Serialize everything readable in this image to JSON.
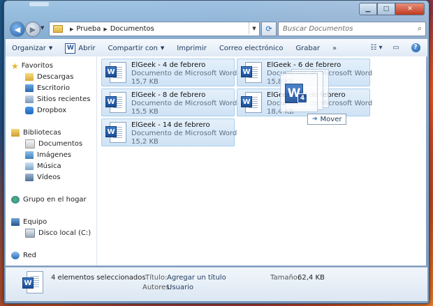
{
  "nav": {
    "breadcrumb": [
      "Prueba",
      "Documentos"
    ],
    "search_placeholder": "Buscar Documentos"
  },
  "toolbar": {
    "organize": "Organizar",
    "open": "Abrir",
    "share": "Compartir con",
    "print": "Imprimir",
    "email": "Correo electrónico",
    "burn": "Grabar",
    "more": "»"
  },
  "sidebar": {
    "favorites": "Favoritos",
    "downloads": "Descargas",
    "desktop": "Escritorio",
    "recent": "Sitios recientes",
    "dropbox": "Dropbox",
    "libraries": "Bibliotecas",
    "documents": "Documentos",
    "images": "Imágenes",
    "music": "Música",
    "videos": "Vídeos",
    "homegroup": "Grupo en el hogar",
    "computer": "Equipo",
    "local_disk": "Disco local (C:)",
    "network": "Red"
  },
  "files": [
    {
      "name": "ElGeek - 4 de febrero",
      "type": "Documento de Microsoft Word",
      "size": "15,7 KB"
    },
    {
      "name": "ElGeek - 6 de febrero",
      "type": "Documento de Microsoft Word",
      "size": "15,8 KB"
    },
    {
      "name": "ElGeek - 8 de febrero",
      "type": "Documento de Microsoft Word",
      "size": "15,5 KB"
    },
    {
      "name": "ElGeek - 12 de febrero",
      "type": "Documento de Microsoft Word",
      "size": "18,4 KB"
    },
    {
      "name": "ElGeek - 14 de febrero",
      "type": "Documento de Microsoft Word",
      "size": "15,2 KB"
    }
  ],
  "drag": {
    "count": "4",
    "tooltip": "Mover"
  },
  "status": {
    "selection": "4 elementos seleccionados",
    "title_label": "Título:",
    "title_value": "Agregar un título",
    "authors_label": "Autores:",
    "authors_value": "Usuario",
    "size_label": "Tamaño:",
    "size_value": "62,4 KB"
  }
}
